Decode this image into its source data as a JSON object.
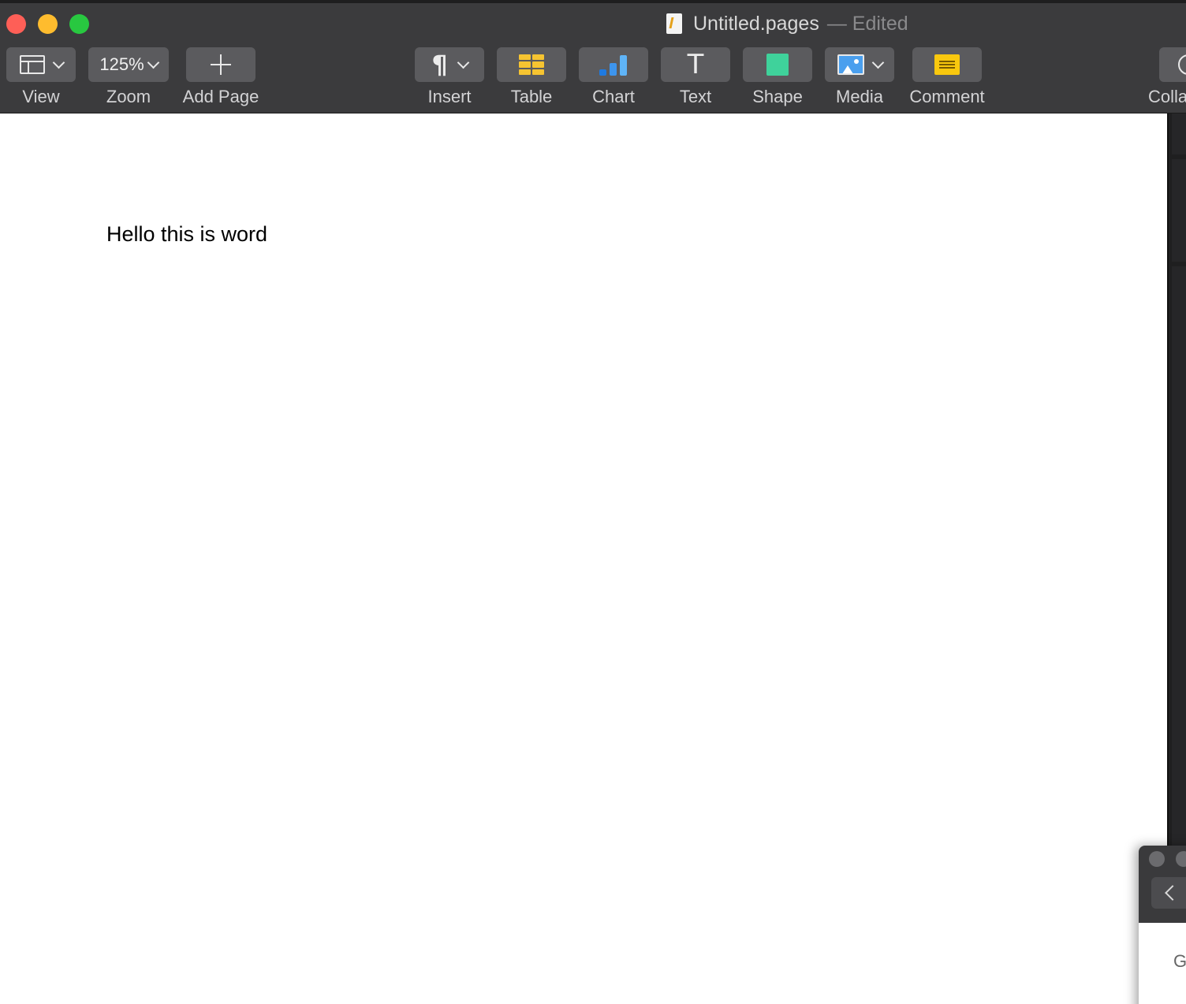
{
  "window": {
    "file_name": "Untitled.pages",
    "status": "— Edited"
  },
  "toolbar": {
    "view_label": "View",
    "zoom_value": "125%",
    "zoom_label": "Zoom",
    "add_page_label": "Add Page",
    "insert_label": "Insert",
    "table_label": "Table",
    "chart_label": "Chart",
    "text_label": "Text",
    "text_icon_glyph": "T",
    "shape_label": "Shape",
    "media_label": "Media",
    "comment_label": "Comment",
    "collaborate_label": "Colla"
  },
  "icons": {
    "view": "sidebar-layout-icon",
    "add_page": "plus-icon",
    "insert": "pilcrow-icon",
    "table": "table-icon",
    "chart": "bar-chart-icon",
    "text": "text-box-icon",
    "shape": "square-shape-icon",
    "media": "photo-icon",
    "comment": "sticky-note-icon",
    "collaborate": "collaborate-icon"
  },
  "colors": {
    "toolbar_bg": "#3b3b3d",
    "button_bg": "#5b5b5e",
    "table_yellow": "#f6c431",
    "chart_blue_1": "#1f7ae0",
    "chart_blue_2": "#3d95ee",
    "chart_blue_3": "#5fb4f7",
    "shape_green": "#3fd29b",
    "comment_yellow": "#f9c80e",
    "close_red": "#fe5f57",
    "minimize_yellow": "#febc2e",
    "zoom_green": "#28c840"
  },
  "document": {
    "body_text": "Hello this is word"
  },
  "mini_window": {
    "partial_text": "G"
  }
}
